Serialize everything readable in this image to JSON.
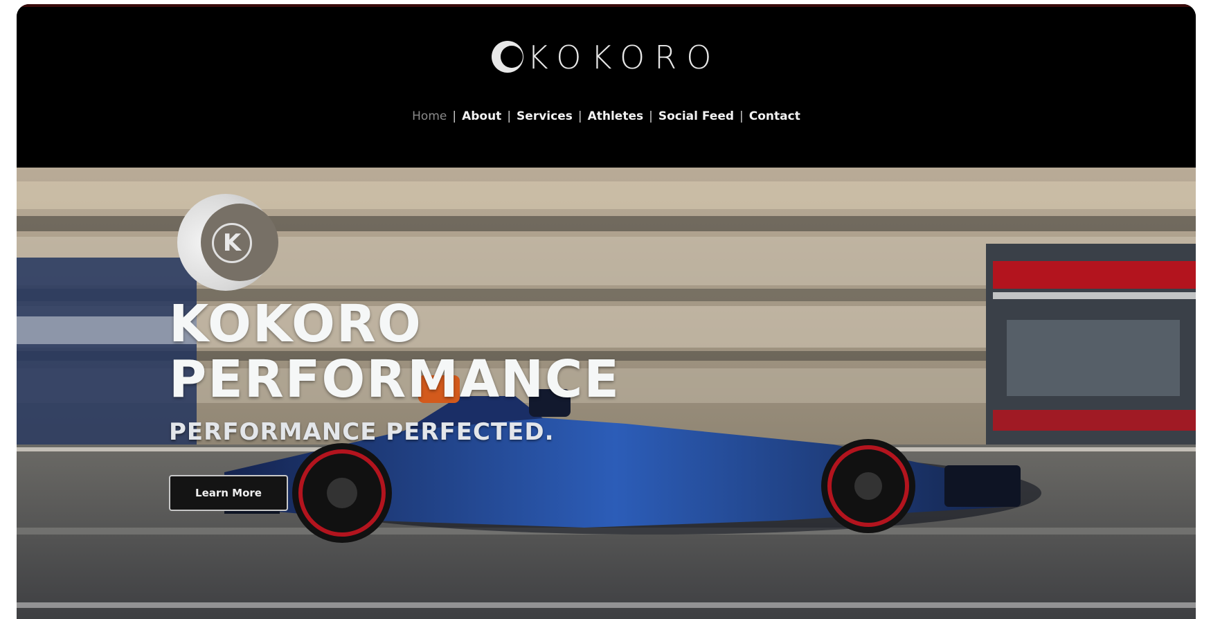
{
  "header": {
    "brand_name": "KOKORO",
    "nav": [
      {
        "label": "Home",
        "active": true
      },
      {
        "label": "About"
      },
      {
        "label": "Services"
      },
      {
        "label": "Athletes"
      },
      {
        "label": "Social Feed"
      },
      {
        "label": "Contact"
      }
    ],
    "logo_icon": "kokoro-crescent-logo-icon"
  },
  "hero": {
    "title_line1": "KOKORO",
    "title_line2": "PERFORMANCE",
    "subtitle": "PERFORMANCE PERFECTED.",
    "cta_label": "Learn More",
    "logo_letter": "K",
    "background_image": "race-car-on-track"
  },
  "colors": {
    "header_bg": "#000000",
    "accent_red": "#b3141e",
    "car_blue": "#1f3f8a",
    "text_light": "#f5f7f7"
  }
}
